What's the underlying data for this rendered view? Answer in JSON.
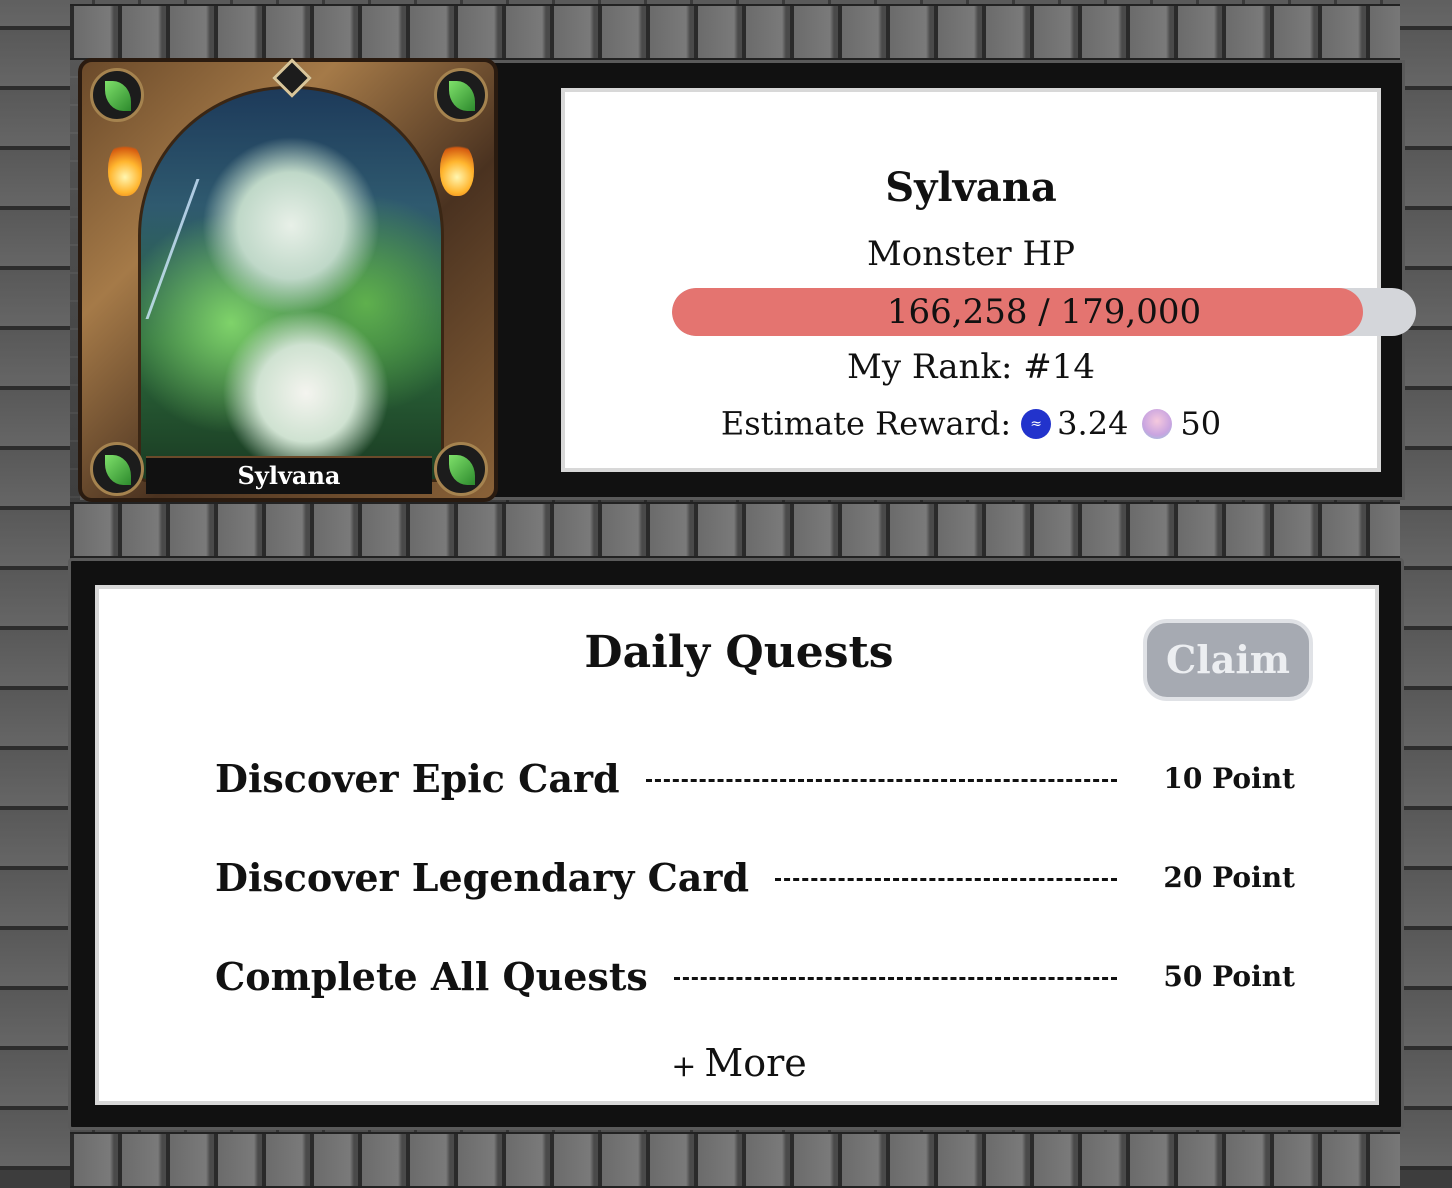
{
  "boss": {
    "name": "Sylvana",
    "hp_label": "Monster HP",
    "hp_text": "166,258 / 179,000",
    "hp_current": 166258,
    "hp_max": 179000,
    "rank_text": "My Rank: #14",
    "reward_label": "Estimate Reward:",
    "reward_coin_value": "3.24",
    "reward_coin_icon": "steem-coin-icon",
    "reward_points_value": "50",
    "reward_points_icon": "avatar-token-icon",
    "hp_fill_color": "#e47470",
    "hp_track_color": "#d4d6da"
  },
  "card": {
    "name": "Sylvana"
  },
  "quests": {
    "title": "Daily Quests",
    "claim_label": "Claim",
    "items": [
      {
        "name": "Discover Epic Card",
        "points": "10 Point"
      },
      {
        "name": "Discover Legendary Card",
        "points": "20 Point"
      },
      {
        "name": "Complete All Quests",
        "points": "50 Point"
      }
    ],
    "more_plus": "+",
    "more_label": "More"
  }
}
